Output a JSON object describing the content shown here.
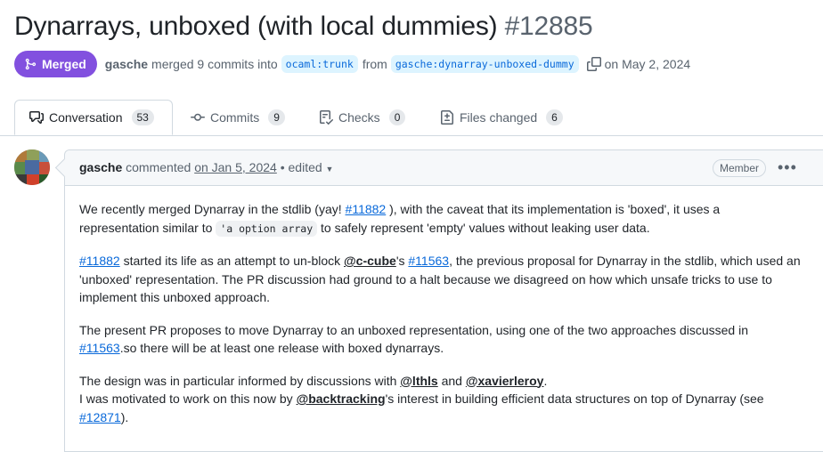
{
  "pr": {
    "title": "Dynarrays, unboxed (with local dummies)",
    "number": "#12885",
    "status": "Merged",
    "author": "gasche",
    "merged_text": "merged 9 commits into",
    "base_branch": "ocaml:trunk",
    "from_text": "from",
    "head_branch": "gasche:dynarray-unboxed-dummy",
    "merged_date": "on May 2, 2024"
  },
  "tabs": [
    {
      "label": "Conversation",
      "count": "53",
      "icon": "comment-discussion-icon"
    },
    {
      "label": "Commits",
      "count": "9",
      "icon": "git-commit-icon"
    },
    {
      "label": "Checks",
      "count": "0",
      "icon": "checklist-icon"
    },
    {
      "label": "Files changed",
      "count": "6",
      "icon": "file-diff-icon"
    }
  ],
  "comment": {
    "author": "gasche",
    "action": "commented",
    "date": "on Jan 5, 2024",
    "edited": "• edited",
    "role": "Member",
    "p1": {
      "a": "We recently merged Dynarray in the stdlib (yay! ",
      "link1": "#11882",
      "b": " ), with the caveat that its implementation is 'boxed', it uses a representation similar to ",
      "code": "'a option array",
      "c": " to safely represent 'empty' values without leaking user data."
    },
    "p2": {
      "link1": "#11882",
      "a": " started its life as an attempt to un-block ",
      "user1": "@c-cube",
      "b": "'s ",
      "link2": "#11563",
      "c": ", the previous proposal for Dynarray in the stdlib, which used an 'unboxed' representation. The PR discussion had ground to a halt because we disagreed on how which unsafe tricks to use to implement this unboxed approach."
    },
    "p3": {
      "a": "The present PR proposes to move Dynarray to an unboxed representation, using one of the two approaches discussed in ",
      "link1": "#11563",
      "b": ".so there will be at least one release with boxed dynarrays."
    },
    "p4": {
      "a": "The design was in particular informed by discussions with ",
      "user1": "@lthls",
      "b": " and ",
      "user2": "@xavierleroy",
      "c": ".",
      "d": "I was motivated to work on this now by ",
      "user3": "@backtracking",
      "e": "'s interest in building efficient data structures on top of Dynarray (see ",
      "link1": "#12871",
      "f": ")."
    }
  },
  "colors": {
    "merged": "#8250df",
    "link": "#0969da",
    "muted": "#59636e"
  }
}
